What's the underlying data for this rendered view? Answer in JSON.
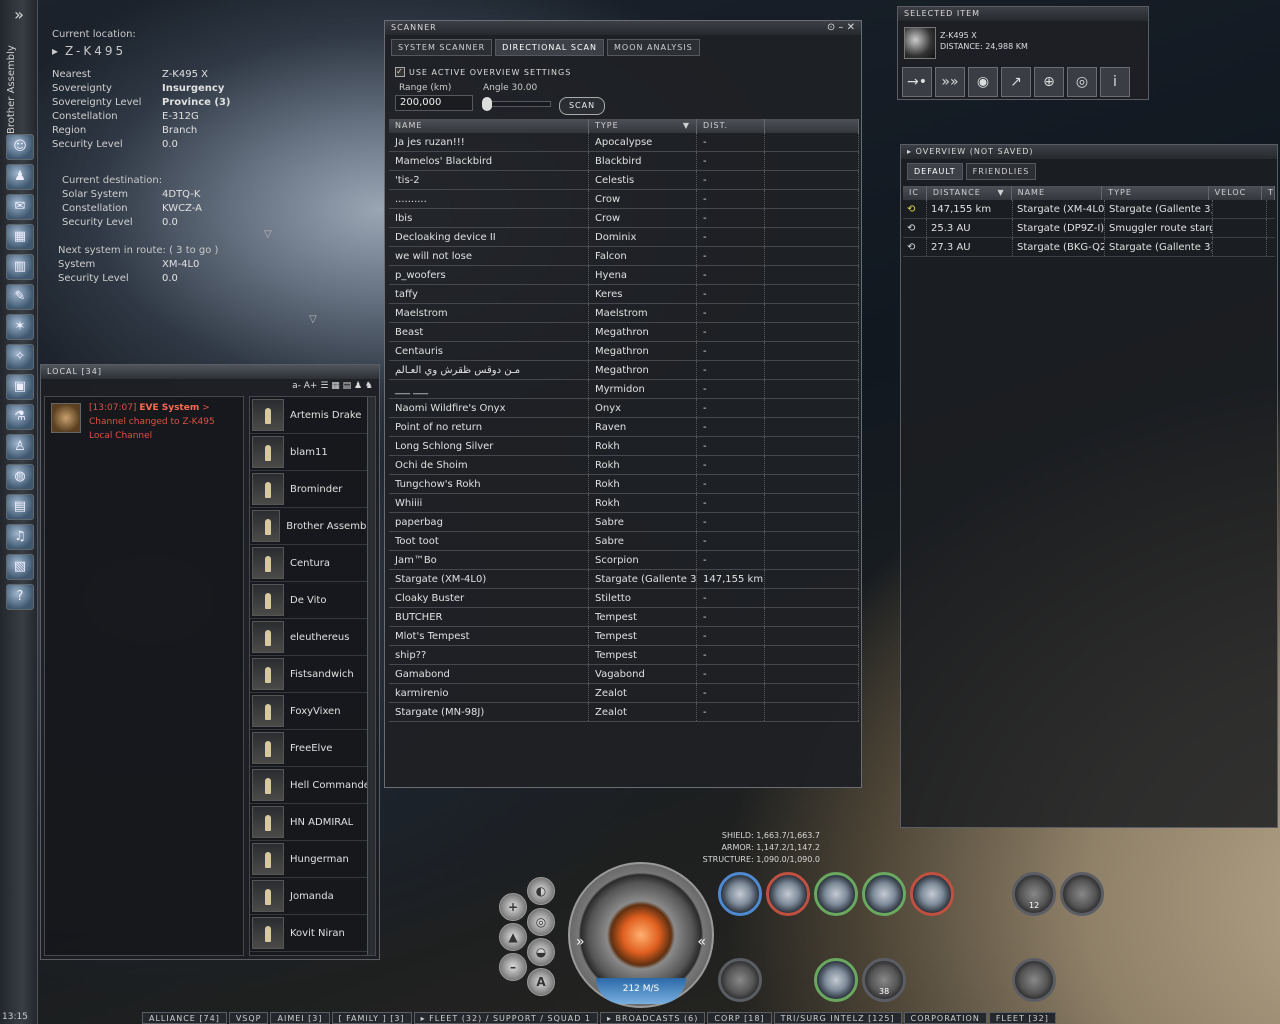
{
  "neocom": {
    "title": "Brother Assembly",
    "menu_glyph": "»",
    "clock": "13:15"
  },
  "location": {
    "current_label": "Current location:",
    "current": "Z-K495",
    "rows": [
      {
        "k": "Nearest",
        "v": "Z-K495 X"
      },
      {
        "k": "Sovereignty",
        "v": "Insurgency"
      },
      {
        "k": "Sovereignty Level",
        "v": "Province (3)"
      },
      {
        "k": "Constellation",
        "v": "E-312G"
      },
      {
        "k": "Region",
        "v": "Branch"
      },
      {
        "k": "Security Level",
        "v": "0.0"
      }
    ],
    "dest_label": "Current destination:",
    "dest": [
      {
        "k": "Solar System",
        "v": "4DTQ-K"
      },
      {
        "k": "Constellation",
        "v": "KWCZ-A"
      },
      {
        "k": "Security Level",
        "v": "0.0"
      }
    ],
    "next_label": "Next system in route: ( 3 to go )",
    "next": [
      {
        "k": "System",
        "v": "XM-4L0"
      },
      {
        "k": "Security Level",
        "v": "0.0"
      }
    ]
  },
  "local": {
    "title": "LOCAL [34]",
    "font_controls": "a- A+",
    "message": {
      "time": "[13:07:07]",
      "sender": "EVE System",
      "arrow": ">",
      "text1": "Channel changed to Z-K495",
      "text2": "Local Channel"
    },
    "members": [
      "Artemis Drake",
      "blam11",
      "Brominder",
      "Brother Assembly",
      "Centura",
      "De Vito",
      "eleuthereus",
      "Fistsandwich",
      "FoxyVixen",
      "FreeElve",
      "Hell Commander",
      "HN ADMIRAL",
      "Hungerman",
      "Jomanda",
      "Kovit Niran"
    ]
  },
  "scanner": {
    "title": "SCANNER",
    "tabs": [
      "SYSTEM SCANNER",
      "DIRECTIONAL SCAN",
      "MOON ANALYSIS"
    ],
    "use_overview": "USE ACTIVE OVERVIEW SETTINGS",
    "range_label": "Range (km)",
    "range_value": "200,000",
    "angle_label": "Angle 30.00",
    "scan_button": "SCAN",
    "columns": [
      "NAME",
      "TYPE",
      "DIST."
    ],
    "rows": [
      [
        "Ja jes ruzan!!!",
        "Apocalypse",
        "-"
      ],
      [
        "Mamelos' Blackbird",
        "Blackbird",
        "-"
      ],
      [
        "'tis-2",
        "Celestis",
        "-"
      ],
      [
        "..........",
        "Crow",
        "-"
      ],
      [
        "Ibis",
        "Crow",
        "-"
      ],
      [
        "Decloaking device II",
        "Dominix",
        "-"
      ],
      [
        "we will not lose",
        "Falcon",
        "-"
      ],
      [
        "p_woofers",
        "Hyena",
        "-"
      ],
      [
        "taffy",
        "Keres",
        "-"
      ],
      [
        "Maelstrom",
        "Maelstrom",
        "-"
      ],
      [
        "Beast",
        "Megathron",
        "-"
      ],
      [
        "Centauris",
        "Megathron",
        "-"
      ],
      [
        "مـن دوقس ظقرش وي العـالم",
        "Megathron",
        "-"
      ],
      [
        "___ ___",
        "Myrmidon",
        "-"
      ],
      [
        "Naomi Wildfire's Onyx",
        "Onyx",
        "-"
      ],
      [
        "Point of no return",
        "Raven",
        "-"
      ],
      [
        "Long Schlong Silver",
        "Rokh",
        "-"
      ],
      [
        "Ochi de Shoim",
        "Rokh",
        "-"
      ],
      [
        "Tungchow's Rokh",
        "Rokh",
        "-"
      ],
      [
        "Whiiii",
        "Rokh",
        "-"
      ],
      [
        "paperbag",
        "Sabre",
        "-"
      ],
      [
        "Toot toot",
        "Sabre",
        "-"
      ],
      [
        "Jam™Bo",
        "Scorpion",
        "-"
      ],
      [
        "Stargate (XM-4L0)",
        "Stargate (Gallente 3)",
        "147,155 km"
      ],
      [
        "Cloaky Buster",
        "Stiletto",
        "-"
      ],
      [
        "BUTCHER",
        "Tempest",
        "-"
      ],
      [
        "Mlot's Tempest",
        "Tempest",
        "-"
      ],
      [
        "ship??",
        "Tempest",
        "-"
      ],
      [
        "Gamabond",
        "Vagabond",
        "-"
      ],
      [
        "karmirenio",
        "Zealot",
        "-"
      ],
      [
        "Stargate (MN-98J)",
        "Zealot",
        "-"
      ]
    ]
  },
  "selected": {
    "title": "SELECTED ITEM",
    "name": "Z-K495 X",
    "distance": "DISTANCE: 24,988 KM",
    "buttons": [
      "→•",
      "»»",
      "◉",
      "↗",
      "⊕",
      "◎",
      "i"
    ]
  },
  "overview": {
    "title": "OVERVIEW (NOT SAVED)",
    "tabs": [
      "DEFAULT",
      "FRIENDLIES"
    ],
    "columns": [
      "IC",
      "DISTANCE",
      "NAME",
      "TYPE",
      "VELOC",
      "T"
    ],
    "rows": [
      [
        "147,155 km",
        "Stargate (XM-4L0",
        "Stargate (Gallente 3)"
      ],
      [
        "25.3 AU",
        "Stargate (DP9Z-I)",
        "Smuggler route starg"
      ],
      [
        "27.3 AU",
        "Stargate (BKG-Q2",
        "Stargate (Gallente 3)"
      ]
    ]
  },
  "hud": {
    "shield": "SHIELD: 1,663.7/1,663.7",
    "armor": "ARMOR: 1,147.2/1,147.2",
    "structure": "STRUCTURE: 1,090.0/1,090.0",
    "speed": "212 M/S",
    "drone_count": "12",
    "ammo_count": "38",
    "autopilot_btn": "A"
  },
  "chat_tabs": [
    "ALLIANCE [74]",
    "VSQP",
    "AIMEI [3]",
    "[ FAMILY ] [3]",
    "▸ FLEET (32) / SUPPORT / SQUAD 1",
    "▸ BROADCASTS (6)",
    "CORP [18]",
    "TRI/SURG INTELZ [125]",
    "CORPORATION",
    "FLEET [32]"
  ]
}
